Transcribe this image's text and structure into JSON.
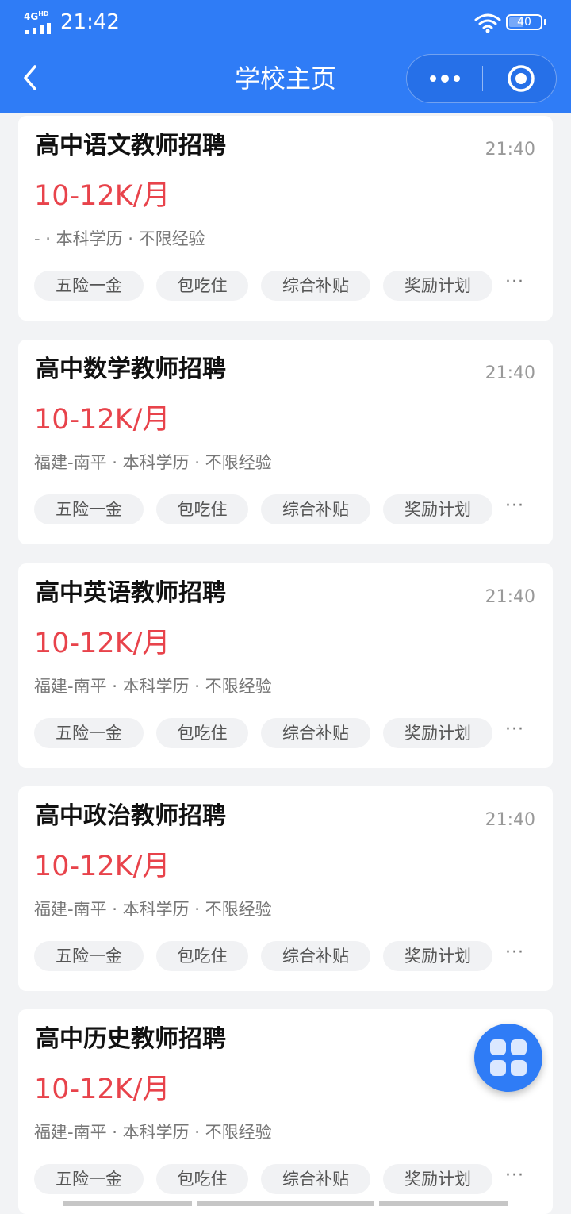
{
  "status_bar": {
    "network": "4G",
    "network_sup": "HD",
    "time": "21:42",
    "battery": "40"
  },
  "nav": {
    "title": "学校主页"
  },
  "jobs": [
    {
      "title": "高中语文教师招聘",
      "time": "21:40",
      "salary": "10-12K/月",
      "meta": "- · 本科学历 · 不限经验",
      "tags": [
        "五险一金",
        "包吃住",
        "综合补贴",
        "奖励计划"
      ],
      "more": "···"
    },
    {
      "title": "高中数学教师招聘",
      "time": "21:40",
      "salary": "10-12K/月",
      "meta": "福建-南平 · 本科学历 · 不限经验",
      "tags": [
        "五险一金",
        "包吃住",
        "综合补贴",
        "奖励计划"
      ],
      "more": "···"
    },
    {
      "title": "高中英语教师招聘",
      "time": "21:40",
      "salary": "10-12K/月",
      "meta": "福建-南平 · 本科学历 · 不限经验",
      "tags": [
        "五险一金",
        "包吃住",
        "综合补贴",
        "奖励计划"
      ],
      "more": "···"
    },
    {
      "title": "高中政治教师招聘",
      "time": "21:40",
      "salary": "10-12K/月",
      "meta": "福建-南平 · 本科学历 · 不限经验",
      "tags": [
        "五险一金",
        "包吃住",
        "综合补贴",
        "奖励计划"
      ],
      "more": "···"
    },
    {
      "title": "高中历史教师招聘",
      "time": "",
      "salary": "10-12K/月",
      "meta": "福建-南平 · 本科学历 · 不限经验",
      "tags": [
        "五险一金",
        "包吃住",
        "综合补贴",
        "奖励计划"
      ],
      "more": "···"
    }
  ],
  "colors": {
    "brand": "#2f7cf6",
    "salary": "#e8434b"
  },
  "icons": {
    "back": "chevron-left-icon",
    "more": "more-dots-icon",
    "close": "target-circle-icon",
    "fab": "app-grid-icon"
  }
}
